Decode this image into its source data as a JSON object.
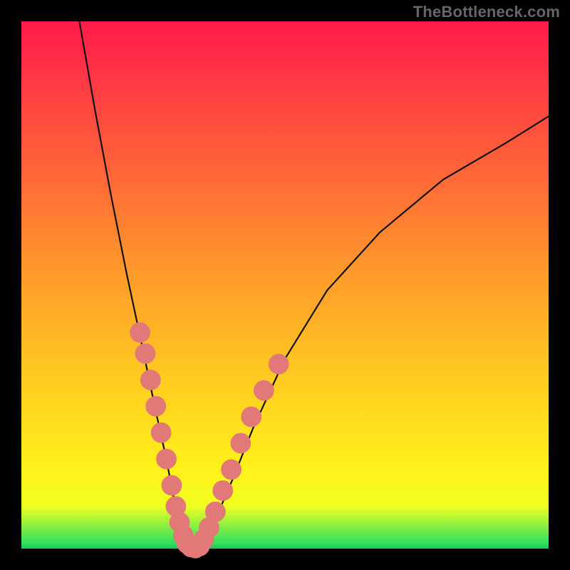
{
  "watermark": "TheBottleneck.com",
  "chart_data": {
    "type": "line",
    "title": "",
    "xlabel": "",
    "ylabel": "",
    "xlim": [
      0,
      100
    ],
    "ylim": [
      0,
      100
    ],
    "background_gradient": {
      "direction": "vertical",
      "stops": [
        {
          "pos": 0,
          "color": "#ff1a4a"
        },
        {
          "pos": 12,
          "color": "#ff3b44"
        },
        {
          "pos": 28,
          "color": "#ff6438"
        },
        {
          "pos": 50,
          "color": "#ffa02a"
        },
        {
          "pos": 70,
          "color": "#ffd020"
        },
        {
          "pos": 85,
          "color": "#fff21a"
        },
        {
          "pos": 92,
          "color": "#f0ff20"
        },
        {
          "pos": 99,
          "color": "#30e060"
        },
        {
          "pos": 100,
          "color": "#18c850"
        }
      ]
    },
    "series": [
      {
        "name": "left-branch",
        "x": [
          11,
          14,
          17,
          20,
          23,
          25.5,
          27.5,
          29,
          30.2,
          31,
          31.8
        ],
        "y": [
          100,
          83,
          67,
          52,
          38,
          26,
          17,
          9,
          4,
          1,
          0
        ]
      },
      {
        "name": "right-branch",
        "x": [
          33.5,
          35,
          37,
          40,
          44,
          50,
          58,
          68,
          80,
          92,
          100
        ],
        "y": [
          0,
          2,
          6,
          13,
          23,
          36,
          49,
          60,
          70,
          77,
          82
        ]
      }
    ],
    "markers": [
      {
        "x": 22.5,
        "y": 41,
        "r": 1.2
      },
      {
        "x": 23.5,
        "y": 37,
        "r": 1.2
      },
      {
        "x": 24.5,
        "y": 32,
        "r": 1.2
      },
      {
        "x": 25.5,
        "y": 27,
        "r": 1.2
      },
      {
        "x": 26.5,
        "y": 22,
        "r": 1.2
      },
      {
        "x": 27.5,
        "y": 17,
        "r": 1.2
      },
      {
        "x": 28.5,
        "y": 12,
        "r": 1.2
      },
      {
        "x": 29.3,
        "y": 8,
        "r": 1.2
      },
      {
        "x": 30.0,
        "y": 5,
        "r": 1.2
      },
      {
        "x": 30.7,
        "y": 2.5,
        "r": 1.2
      },
      {
        "x": 31.4,
        "y": 1,
        "r": 1.2
      },
      {
        "x": 32.2,
        "y": 0.3,
        "r": 1.2
      },
      {
        "x": 33.0,
        "y": 0.1,
        "r": 1.2
      },
      {
        "x": 33.8,
        "y": 0.5,
        "r": 1.2
      },
      {
        "x": 34.6,
        "y": 1.8,
        "r": 1.2
      },
      {
        "x": 35.6,
        "y": 4,
        "r": 1.2
      },
      {
        "x": 36.8,
        "y": 7,
        "r": 1.2
      },
      {
        "x": 38.2,
        "y": 11,
        "r": 1.2
      },
      {
        "x": 39.8,
        "y": 15,
        "r": 1.2
      },
      {
        "x": 41.6,
        "y": 20,
        "r": 1.2
      },
      {
        "x": 43.6,
        "y": 25,
        "r": 1.2
      },
      {
        "x": 46.0,
        "y": 30,
        "r": 1.2
      },
      {
        "x": 48.8,
        "y": 35,
        "r": 1.2
      }
    ]
  }
}
